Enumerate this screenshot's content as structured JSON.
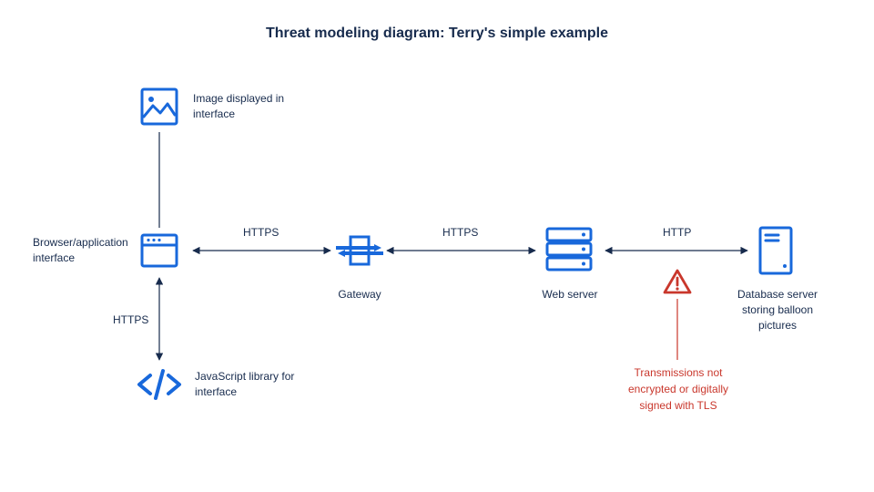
{
  "title": "Threat modeling diagram: Terry's simple example",
  "nodes": {
    "image": {
      "label": "Image displayed in interface"
    },
    "browser": {
      "label": "Browser/application interface"
    },
    "jslib": {
      "label": "JavaScript library for interface"
    },
    "gateway": {
      "label": "Gateway"
    },
    "webserver": {
      "label": "Web server"
    },
    "database": {
      "label": "Database server storing balloon pictures"
    }
  },
  "connections": {
    "browser_gateway": {
      "label": "HTTPS"
    },
    "gateway_webserver": {
      "label": "HTTPS"
    },
    "webserver_database": {
      "label": "HTTP"
    },
    "browser_jslib": {
      "label": "HTTPS"
    }
  },
  "warning": {
    "label": "Transmissions not encrypted or digitally signed with TLS"
  },
  "colors": {
    "primary": "#1868db",
    "text": "#172b4d",
    "danger": "#c9372c"
  }
}
